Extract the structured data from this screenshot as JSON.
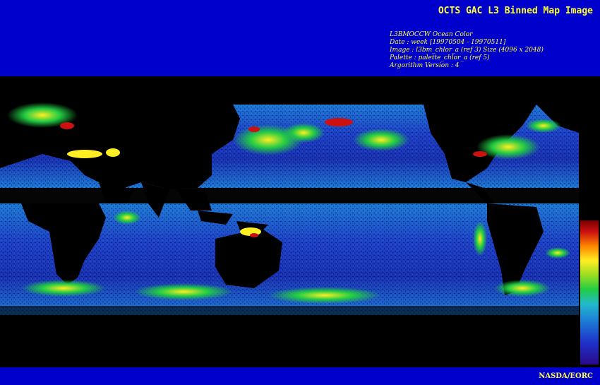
{
  "header": {
    "title": "OCTS GAC L3 Binned Map Image",
    "meta_lines": [
      "L3BMOCCW Ocean Color",
      "Date : week [19970504 - 19970511]",
      "Image : l3bm_chlor_a (ref 3) Size (4096 x 2048)",
      "Palette : palette_chlor_a (ref 5)",
      "Argorithm Version : 4"
    ]
  },
  "footer": {
    "credit": "NASDA/EORC"
  },
  "colors": {
    "banner": "#0000cc",
    "text": "#ffff33",
    "land": "#000000",
    "ocean_low": "#1e32c8",
    "ocean_mid": "#1e7ad6",
    "bloom_green": "#22cc44",
    "bloom_yellow": "#ffee22",
    "bloom_red": "#cc1111"
  },
  "palette": {
    "colors": [
      "#2a0a8a",
      "#1e32c8",
      "#1e7ad6",
      "#22bbcc",
      "#22cc44",
      "#99dd22",
      "#ffee22",
      "#ff8800",
      "#cc1111",
      "#770000"
    ]
  }
}
